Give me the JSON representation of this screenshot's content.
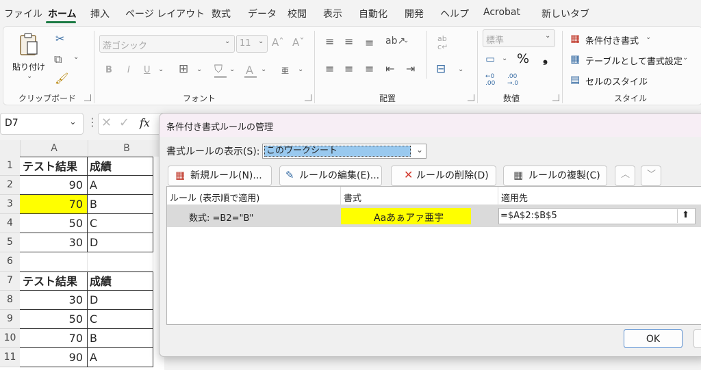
{
  "menu": {
    "items": [
      "ファイル",
      "ホーム",
      "挿入",
      "ページ レイアウト",
      "数式",
      "データ",
      "校閲",
      "表示",
      "自動化",
      "開発",
      "ヘルプ",
      "Acrobat",
      "新しいタブ"
    ],
    "active": "ホーム"
  },
  "ribbon": {
    "clipboard": {
      "paste": "貼り付け",
      "group": "クリップボード"
    },
    "font": {
      "name": "游ゴシック",
      "size": "11",
      "grow": "A^",
      "shrink": "A˅",
      "bold": "B",
      "italic": "I",
      "underline": "U",
      "phonetic": "亜",
      "group": "フォント"
    },
    "alignment": {
      "group": "配置",
      "wrap": "ab c↵"
    },
    "number": {
      "format": "標準",
      "percent": "%",
      "comma": "9",
      "inc": ".0 .00",
      "group": "数値"
    },
    "styles": {
      "conditional": "条件付き書式",
      "table": "テーブルとして書式設定",
      "cell": "セルのスタイル",
      "group": "スタイル"
    }
  },
  "formula_bar": {
    "name_box": "D7",
    "fx": "fx"
  },
  "sheet": {
    "columns": [
      "A",
      "B"
    ],
    "rows": [
      {
        "num": "1",
        "a": "テスト結果",
        "b": "成績",
        "header": true
      },
      {
        "num": "2",
        "a": "90",
        "b": "A"
      },
      {
        "num": "3",
        "a": "70",
        "b": "B",
        "highlight": true
      },
      {
        "num": "4",
        "a": "50",
        "b": "C"
      },
      {
        "num": "5",
        "a": "30",
        "b": "D"
      },
      {
        "num": "6",
        "a": "",
        "b": ""
      },
      {
        "num": "7",
        "a": "テスト結果",
        "b": "成績",
        "header": true
      },
      {
        "num": "8",
        "a": "30",
        "b": "D"
      },
      {
        "num": "9",
        "a": "50",
        "b": "C"
      },
      {
        "num": "10",
        "a": "70",
        "b": "B"
      },
      {
        "num": "11",
        "a": "90",
        "b": "A"
      }
    ],
    "highlight_color": "#ffff00"
  },
  "dialog": {
    "title": "条件付き書式ルールの管理",
    "show_rules_label": "書式ルールの表示(S):",
    "show_rules_value": "このワークシート",
    "buttons": {
      "new_rule": "新規ルール(N)...",
      "edit_rule": "ルールの編集(E)...",
      "delete_rule": "ルールの削除(D)",
      "duplicate_rule": "ルールの複製(C)"
    },
    "columns": {
      "rule": "ルール (表示順で適用)",
      "format": "書式",
      "applies_to": "適用先"
    },
    "rules": [
      {
        "rule": "数式: =B2=\"B\"",
        "format_preview": "Aaあぁアァ亜宇",
        "applies_to": "=$A$2:$B$5",
        "format_color": "#ffff00"
      }
    ],
    "ok": "OK"
  }
}
